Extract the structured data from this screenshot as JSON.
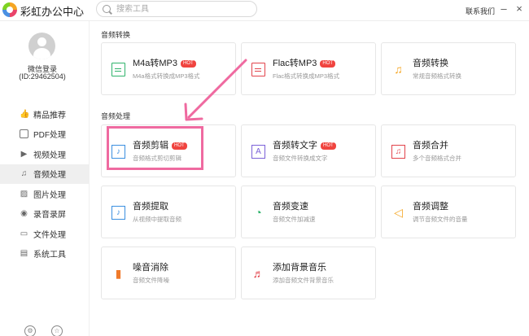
{
  "app": {
    "title": "彩虹办公中心"
  },
  "search": {
    "placeholder": "搜索工具"
  },
  "header": {
    "contact_label": "联系我们",
    "minimize_icon": "minimize-icon",
    "close_icon": "close-icon"
  },
  "user": {
    "login_label": "微信登录",
    "id_text": "(ID:29462504)"
  },
  "sidebar": {
    "items": [
      {
        "label": "精品推荐",
        "icon": "thumbs-up-icon",
        "glyph": "👍"
      },
      {
        "label": "PDF处理",
        "icon": "pdf-icon",
        "glyph": "P"
      },
      {
        "label": "视频处理",
        "icon": "video-icon",
        "glyph": "▶"
      },
      {
        "label": "音频处理",
        "icon": "music-icon",
        "glyph": "♫",
        "active": true
      },
      {
        "label": "图片处理",
        "icon": "image-icon",
        "glyph": "▨"
      },
      {
        "label": "录音录屏",
        "icon": "record-icon",
        "glyph": "◉"
      },
      {
        "label": "文件处理",
        "icon": "folder-icon",
        "glyph": "▭"
      },
      {
        "label": "系统工具",
        "icon": "tools-icon",
        "glyph": "▤"
      }
    ]
  },
  "sections": [
    {
      "title": "音频转换",
      "cards": [
        {
          "title": "M4a转MP3",
          "hot": "HOT",
          "desc": "M4a格式转换成MP3格式",
          "icon": "m4a-icon",
          "color": "#2fb36b"
        },
        {
          "title": "Flac转MP3",
          "hot": "HOT",
          "desc": "Flac格式转换成MP3格式",
          "icon": "flac-icon",
          "color": "#e2434b"
        },
        {
          "title": "音频转换",
          "hot": "",
          "desc": "常规音频格式转换",
          "icon": "audio-convert-icon",
          "color": "#f5a623"
        }
      ]
    },
    {
      "title": "音频处理",
      "cards": [
        {
          "title": "音频剪辑",
          "hot": "HOT",
          "desc": "音频格式剪切剪辑",
          "icon": "audio-cut-icon",
          "color": "#3b8fe0"
        },
        {
          "title": "音频转文字",
          "hot": "HOT",
          "desc": "音频文件转换成文字",
          "icon": "audio-to-text-icon",
          "color": "#7b61d8"
        },
        {
          "title": "音频合并",
          "hot": "",
          "desc": "多个音频格式合并",
          "icon": "audio-merge-icon",
          "color": "#e2434b"
        },
        {
          "title": "音频提取",
          "hot": "",
          "desc": "从视频中提取音频",
          "icon": "audio-extract-icon",
          "color": "#3b8fe0"
        },
        {
          "title": "音频变速",
          "hot": "",
          "desc": "音频文件加减速",
          "icon": "audio-speed-icon",
          "color": "#2fb36b"
        },
        {
          "title": "音频调整",
          "hot": "",
          "desc": "调节音频文件的音量",
          "icon": "volume-icon",
          "color": "#f5a623"
        },
        {
          "title": "噪音消除",
          "hot": "",
          "desc": "音频文件降噪",
          "icon": "noise-removal-icon",
          "color": "#f07a2a"
        },
        {
          "title": "添加背景音乐",
          "hot": "",
          "desc": "添加音频文件背景音乐",
          "icon": "bg-music-icon",
          "color": "#e2434b"
        }
      ]
    }
  ],
  "annotation": {
    "color": "#ef6aa0"
  }
}
